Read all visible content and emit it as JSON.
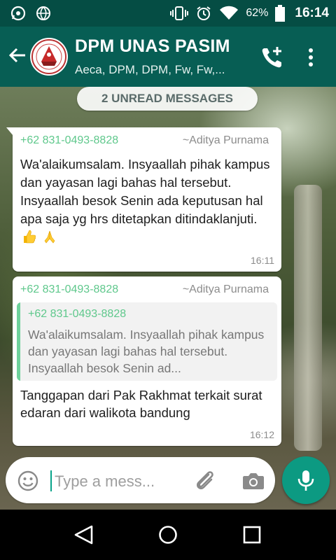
{
  "status_bar": {
    "battery_percent": "62%",
    "time": "16:14"
  },
  "header": {
    "title": "DPM UNAS PASIM",
    "subtitle": "Aeca, DPM, DPM, Fw, Fw,..."
  },
  "chat": {
    "unread_label": "2 UNREAD MESSAGES",
    "messages": [
      {
        "phone": "+62 831-0493-8828",
        "author": "~Aditya Purnama",
        "text": "Wa'alaikumsalam. Insyaallah pihak kampus dan yayasan lagi bahas hal tersebut. Insyaallah besok Senin ada keputusan hal apa saja yg hrs ditetapkan ditindaklanjuti.",
        "emojis": [
          "thumbs-up-emoji",
          "folded-hands-emoji"
        ],
        "time": "16:11"
      },
      {
        "phone": "+62 831-0493-8828",
        "author": "~Aditya Purnama",
        "quote": {
          "phone": "+62 831-0493-8828",
          "text": "Wa'alaikumsalam. Insyaallah pihak kampus dan yayasan lagi bahas hal tersebut. Insyaallah besok Senin ad..."
        },
        "text": "Tanggapan dari Pak Rakhmat terkait surat edaran dari walikota bandung",
        "time": "16:12"
      }
    ]
  },
  "composer": {
    "placeholder": "Type a mess..."
  },
  "colors": {
    "header": "#075e54",
    "status_bar": "#054d44",
    "accent": "#0c9a82",
    "sender_phone": "#5fc88c"
  }
}
